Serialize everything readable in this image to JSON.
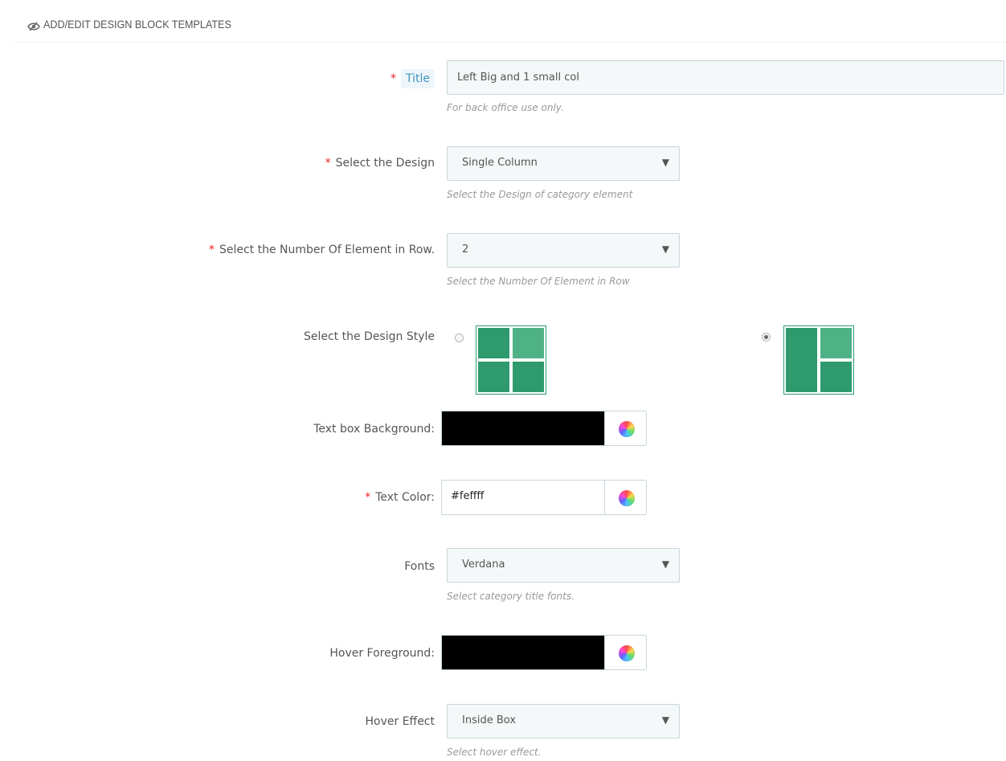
{
  "header": {
    "title": "ADD/EDIT DESIGN BLOCK TEMPLATES",
    "icon": "eye-slash-icon"
  },
  "form": {
    "title": {
      "label": "Title",
      "required": true,
      "value": "Left Big and 1 small col",
      "help": "For back office use only."
    },
    "design": {
      "label": "Select the Design",
      "required": true,
      "value": "Single Column",
      "help": "Select the Design of category element"
    },
    "elements_per_row": {
      "label": "Select the Number Of Element in Row.",
      "required": true,
      "value": "2",
      "help": "Select the Number Of Element in Row"
    },
    "design_style": {
      "label": "Select the Design Style",
      "options": [
        {
          "name": "four-equal-grid",
          "selected": false
        },
        {
          "name": "left-big-two-small",
          "selected": true
        }
      ]
    },
    "textbox_background": {
      "label": "Text box Background:",
      "value": "#000000"
    },
    "text_color": {
      "label": "Text Color:",
      "required": true,
      "value": "#feffff"
    },
    "fonts": {
      "label": "Fonts",
      "value": "Verdana",
      "help": "Select category title fonts."
    },
    "hover_foreground": {
      "label": "Hover Foreground:",
      "value": "#000000"
    },
    "hover_effect": {
      "label": "Hover Effect",
      "value": "Inside Box",
      "help": "Select hover effect."
    }
  },
  "colors": {
    "accent_green": "#2e9a6e",
    "required_star": "#e22222",
    "title_tag_text": "#3e97bf"
  },
  "symbols": {
    "required": "*",
    "caret": "▼"
  }
}
